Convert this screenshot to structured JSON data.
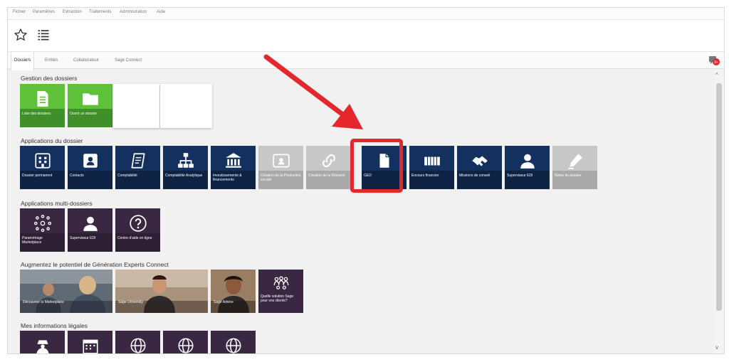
{
  "menu": [
    "Fichier",
    "Paramètres",
    "Extraction",
    "Traitements",
    "Administration",
    "Aide"
  ],
  "toolbar": {
    "favorites_icon": "star-outline-icon",
    "list_icon": "list-icon"
  },
  "tabs": [
    "Dossiers",
    "Entités",
    "Collaborateur",
    "Sage Connect"
  ],
  "active_tab": "Dossiers",
  "notification_badge": "9+",
  "sections": {
    "gestion": {
      "title": "Gestion des dossiers",
      "tiles": [
        {
          "label": "Liste des dossiers",
          "icon": "document-icon",
          "color": "#5ec139"
        },
        {
          "label": "Ouvrir un dossier",
          "icon": "folder-icon",
          "color": "#5ec139"
        }
      ]
    },
    "applications": {
      "title": "Applications du dossier",
      "tiles": [
        {
          "label": "Dossier permanent",
          "icon": "building-icon",
          "color": "#14305f"
        },
        {
          "label": "Contacts",
          "icon": "contact-card-icon",
          "color": "#14305f"
        },
        {
          "label": "Comptabilité",
          "icon": "ledger-icon",
          "color": "#14305f"
        },
        {
          "label": "Comptabilité Analytique",
          "icon": "org-chart-icon",
          "color": "#14305f"
        },
        {
          "label": "Investissements & financements",
          "icon": "bank-icon",
          "color": "#14305f"
        },
        {
          "label": "Création de la Production sociale",
          "icon": "id-card-icon",
          "color": "#c7c7c7"
        },
        {
          "label": "Création de la Révision",
          "icon": "link-icon",
          "color": "#c7c7c7"
        },
        {
          "label": "GED",
          "icon": "file-icon",
          "color": "#14305f"
        },
        {
          "label": "Encours financier",
          "icon": "money-icon",
          "color": "#14305f"
        },
        {
          "label": "Missions de conseil",
          "icon": "handshake-icon",
          "color": "#14305f"
        },
        {
          "label": "Superviseur EDI",
          "icon": "user-icon",
          "color": "#14305f"
        },
        {
          "label": "Notes du dossier",
          "icon": "pencil-icon",
          "color": "#c7c7c7"
        }
      ]
    },
    "multi": {
      "title": "Applications multi-dossiers",
      "tiles": [
        {
          "label": "Paramétrage Marketplace",
          "icon": "network-icon",
          "color": "#3a2842"
        },
        {
          "label": "Superviseur EDI",
          "icon": "user-icon",
          "color": "#3a2842"
        },
        {
          "label": "Centre d'aide en ligne",
          "icon": "question-icon",
          "color": "#3a2842"
        }
      ]
    },
    "augmentez": {
      "title": "Augmentez le potentiel de Génération Experts Connect",
      "tiles": [
        {
          "label": "Découvrez la Marketplace",
          "icon": "photo-office-icon"
        },
        {
          "label": "Sage University",
          "icon": "photo-woman-icon"
        },
        {
          "label": "Sage Advice",
          "icon": "photo-portrait-icon"
        },
        {
          "label": "Quelle solution Sage pour vos clients?",
          "icon": "people-icon",
          "color": "#3a2842"
        }
      ]
    },
    "legales": {
      "title": "Mes informations légales",
      "tiles": [
        {
          "icon": "detective-icon"
        },
        {
          "icon": "calendar-icon"
        },
        {
          "icon": "globe-icon"
        },
        {
          "icon": "globe-icon"
        },
        {
          "icon": "globe-icon"
        }
      ]
    }
  },
  "annotation": {
    "highlight_color": "#e4262d",
    "target": "GED"
  }
}
